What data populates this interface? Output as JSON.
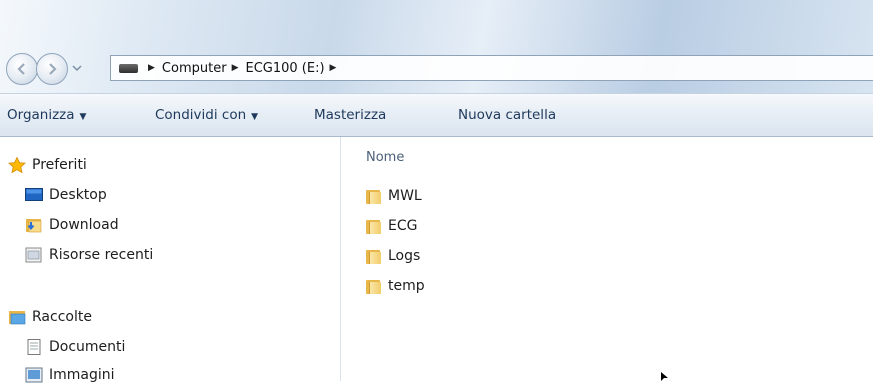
{
  "address": {
    "crumbs": [
      "Computer",
      "ECG100 (E:)"
    ],
    "separator": "▶"
  },
  "toolbar": {
    "organize": "Organizza",
    "share": "Condividi con",
    "burn": "Masterizza",
    "new_folder": "Nuova cartella"
  },
  "nav": {
    "favorites": {
      "label": "Preferiti",
      "icon": "star-icon",
      "items": [
        {
          "label": "Desktop",
          "icon": "desktop-icon"
        },
        {
          "label": "Download",
          "icon": "download-folder-icon"
        },
        {
          "label": "Risorse recenti",
          "icon": "recent-places-icon"
        }
      ]
    },
    "libraries": {
      "label": "Raccolte",
      "icon": "libraries-icon",
      "items": [
        {
          "label": "Documenti",
          "icon": "documents-icon"
        },
        {
          "label": "Immagini",
          "icon": "pictures-icon"
        }
      ]
    }
  },
  "content": {
    "column_header": "Nome",
    "files": [
      {
        "name": "MWL",
        "icon": "folder-icon"
      },
      {
        "name": "ECG",
        "icon": "folder-icon"
      },
      {
        "name": "Logs",
        "icon": "folder-icon"
      },
      {
        "name": "temp",
        "icon": "folder-icon"
      }
    ]
  },
  "colors": {
    "toolbar_text": "#1e395b",
    "folder": "#e9b64a",
    "accent": "#ffb900"
  }
}
